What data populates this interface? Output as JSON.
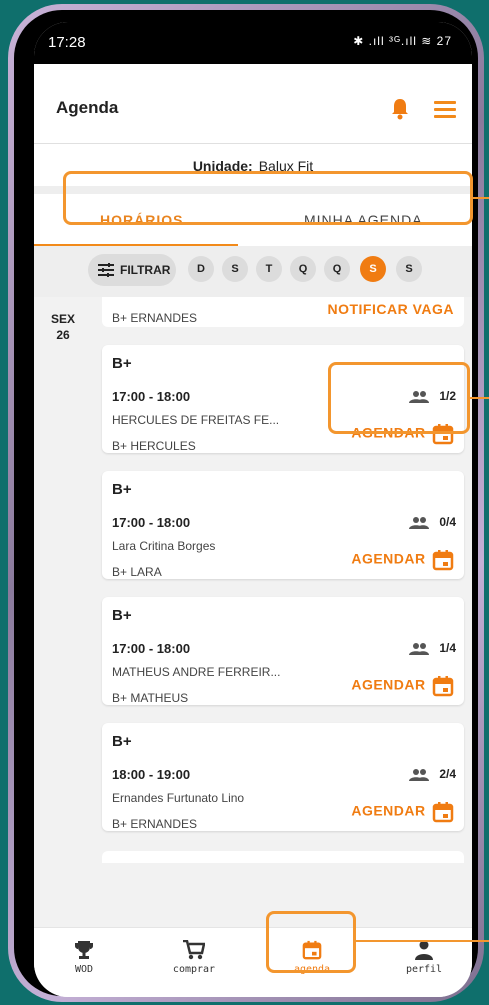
{
  "status_bar": {
    "time": "17:28",
    "icons": "✱ .ıll ³ᴳ.ıll ≋ 27"
  },
  "header": {
    "title": "Agenda"
  },
  "unit": {
    "label": "Unidade:",
    "value": "Balux Fit"
  },
  "tabs": [
    {
      "label": "HORÁRIOS",
      "active": true
    },
    {
      "label": "MINHA AGENDA",
      "active": false
    }
  ],
  "filter": {
    "label": "FILTRAR"
  },
  "days": [
    {
      "label": "D",
      "active": false
    },
    {
      "label": "S",
      "active": false
    },
    {
      "label": "T",
      "active": false
    },
    {
      "label": "Q",
      "active": false
    },
    {
      "label": "Q",
      "active": false
    },
    {
      "label": "S",
      "active": true
    },
    {
      "label": "S",
      "active": false
    }
  ],
  "date": {
    "weekday": "SEX",
    "day": "26"
  },
  "partial_card": {
    "class": "B+ ERNANDES",
    "action": "NOTIFICAR VAGA"
  },
  "cards": [
    {
      "name": "B+",
      "time": "17:00 - 18:00",
      "teacher": "HERCULES DE FREITAS FE...",
      "class": "B+ HERCULES",
      "count": "1/2",
      "action": "AGENDAR"
    },
    {
      "name": "B+",
      "time": "17:00 - 18:00",
      "teacher": "Lara Critina Borges",
      "class": "B+ LARA",
      "count": "0/4",
      "action": "AGENDAR"
    },
    {
      "name": "B+",
      "time": "17:00 - 18:00",
      "teacher": "MATHEUS ANDRE FERREIR...",
      "class": "B+ MATHEUS",
      "count": "1/4",
      "action": "AGENDAR"
    },
    {
      "name": "B+",
      "time": "18:00 - 19:00",
      "teacher": "Ernandes Furtunato Lino",
      "class": "B+ ERNANDES",
      "count": "2/4",
      "action": "AGENDAR"
    }
  ],
  "bottom_nav": [
    {
      "label": "WOD",
      "icon": "trophy-icon",
      "active": false
    },
    {
      "label": "comprar",
      "icon": "cart-icon",
      "active": false
    },
    {
      "label": "agenda",
      "icon": "calendar-icon",
      "active": true
    },
    {
      "label": "perfil",
      "icon": "person-icon",
      "active": false
    }
  ],
  "colors": {
    "accent": "#f07c12",
    "highlight": "#f3962e",
    "background": "#0f6f6c"
  }
}
